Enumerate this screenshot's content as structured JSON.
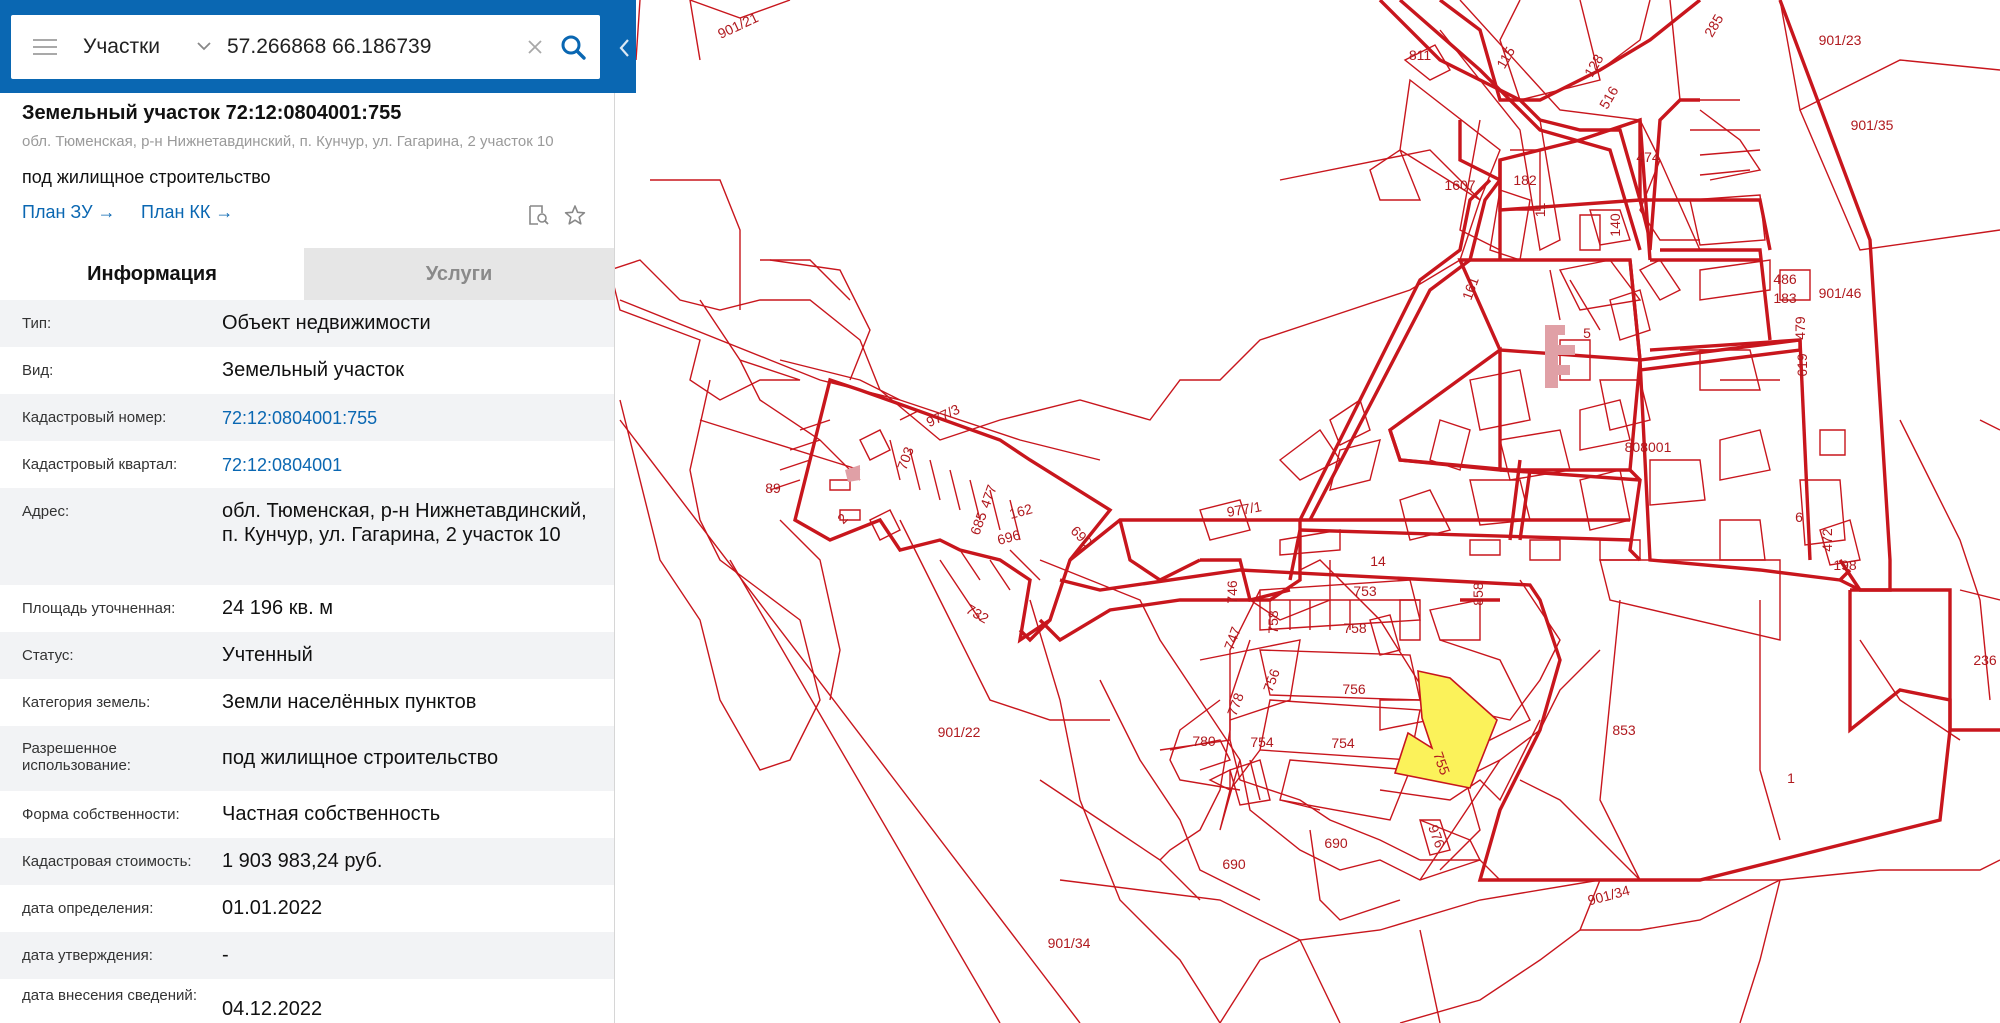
{
  "search": {
    "category": "Участки",
    "query": "57.266868 66.186739"
  },
  "parcel": {
    "title": "Земельный участок 72:12:0804001:755",
    "address_short": "обл. Тюменская, р-н Нижнетавдинский, п. Кунчур, ул. Гагарина, 2 участок 10",
    "usage": "под жилищное строительство",
    "plan_zu": "План ЗУ",
    "plan_kk": "План КК"
  },
  "tabs": {
    "info": "Информация",
    "services": "Услуги"
  },
  "info_rows": [
    {
      "label": "Тип:",
      "value": "Объект недвижимости"
    },
    {
      "label": "Вид:",
      "value": "Земельный участок"
    },
    {
      "label": "Кадастровый номер:",
      "value": "72:12:0804001:755"
    },
    {
      "label": "Кадастровый квартал:",
      "value": "72:12:0804001"
    },
    {
      "label": "Адрес:",
      "value": "обл. Тюменская, р-н Нижнетавдинский, п. Кунчур, ул. Гагарина, 2 участок 10"
    },
    {
      "label": "Площадь уточненная:",
      "value": "24 196 кв. м"
    },
    {
      "label": "Статус:",
      "value": "Учтенный"
    },
    {
      "label": "Категория земель:",
      "value": "Земли населённых пунктов"
    },
    {
      "label": "Разрешенное использование:",
      "value": "под жилищное строительство"
    },
    {
      "label": "Форма собственности:",
      "value": "Частная собственность"
    },
    {
      "label": "Кадастровая стоимость:",
      "value": "1 903 983,24 руб."
    },
    {
      "label": "дата определения:",
      "value": "01.01.2022"
    },
    {
      "label": "дата утверждения:",
      "value": "-"
    },
    {
      "label": "дата внесения сведений:",
      "value": "04.12.2022"
    }
  ],
  "map_labels": [
    "901/21",
    "811",
    "115",
    "128",
    "285",
    "901/23",
    "901/35",
    "516",
    "474",
    "1607",
    "182",
    "11",
    "140",
    "901/46",
    "161",
    "486",
    "183",
    "479",
    "5",
    "977/3",
    "703",
    "619",
    "808001",
    "89",
    "477",
    "162",
    "685",
    "696",
    "690",
    "2",
    "977/1",
    "6",
    "472",
    "198",
    "14",
    "753",
    "858",
    "746",
    "758",
    "758",
    "747",
    "756",
    "756",
    "236",
    "732",
    "901/22",
    "778",
    "780",
    "754",
    "754",
    "755",
    "853",
    "1",
    "976",
    "690",
    "690",
    "901/34",
    "901/34"
  ],
  "colors": {
    "header": "#0a67b2",
    "parcel_line": "#c8161d",
    "selected_fill": "#fbf25a",
    "link": "#0a67b2"
  }
}
